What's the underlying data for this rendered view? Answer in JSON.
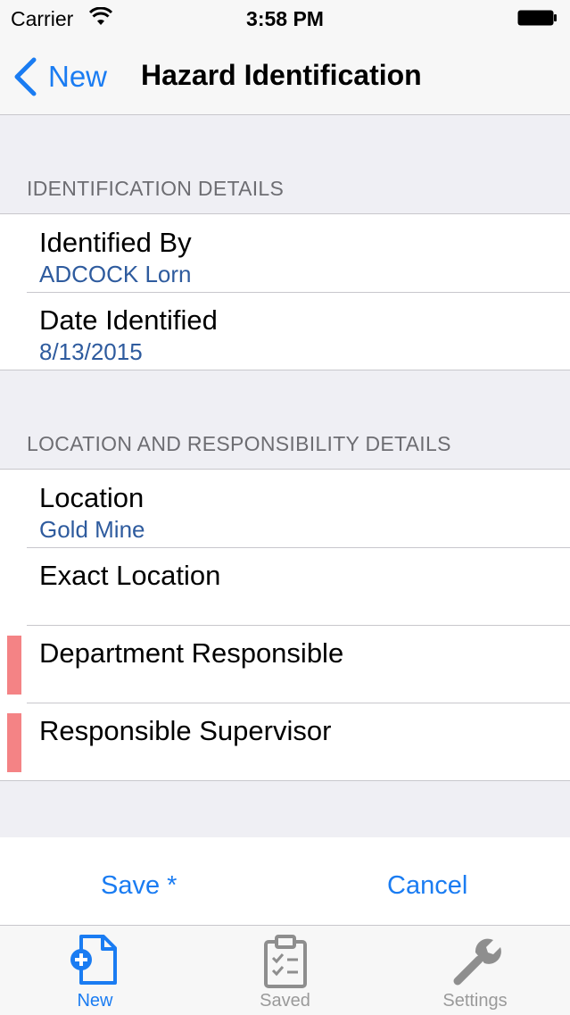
{
  "status_bar": {
    "carrier": "Carrier",
    "time": "3:58 PM"
  },
  "nav": {
    "back_label": "New",
    "title": "Hazard Identification"
  },
  "identification": {
    "header": "IDENTIFICATION DETAILS",
    "identified_by": {
      "label": "Identified By",
      "value": "ADCOCK Lorn"
    },
    "date_identified": {
      "label": "Date Identified",
      "value": "8/13/2015"
    }
  },
  "location_details": {
    "header": "LOCATION AND RESPONSIBILITY DETAILS",
    "location": {
      "label": "Location",
      "value": "Gold Mine"
    },
    "exact_location": {
      "label": "Exact Location"
    },
    "department_responsible": {
      "label": "Department Responsible",
      "required_color": "#f48385"
    },
    "responsible_supervisor": {
      "label": "Responsible Supervisor",
      "required_color": "#f48385"
    }
  },
  "actions": {
    "save_label": "Save *",
    "cancel_label": "Cancel"
  },
  "tabs": [
    {
      "label": "New",
      "icon": "new-document-icon",
      "active": true
    },
    {
      "label": "Saved",
      "icon": "clipboard-checklist-icon",
      "active": false
    },
    {
      "label": "Settings",
      "icon": "wrench-icon",
      "active": false
    }
  ],
  "colors": {
    "accent": "#1a7cf2",
    "value_text": "#2e5b9e",
    "required_marker": "#f48385"
  }
}
